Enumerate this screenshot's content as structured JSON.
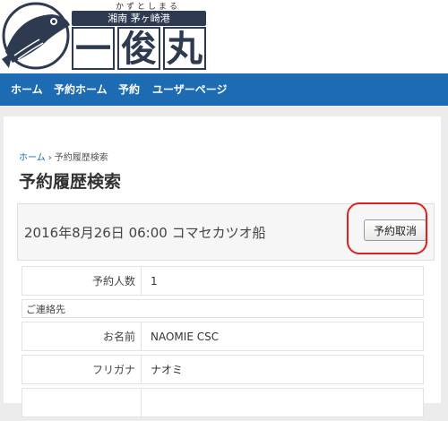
{
  "logo": {
    "furigana": "かずとしまる",
    "port": "湘南 茅ヶ崎港",
    "kanji": [
      "一",
      "俊",
      "丸"
    ]
  },
  "nav": {
    "items": [
      "ホーム",
      "予約ホーム",
      "予約",
      "ユーザーページ"
    ]
  },
  "breadcrumb": {
    "home": "ホーム",
    "separator": "›",
    "current": "予約履歴検索"
  },
  "page_title": "予約履歴検索",
  "booking": {
    "title": "2016年8月26日 06:00 コマセカツオ船",
    "cancel_label": "予約取消"
  },
  "details": {
    "people_label": "予約人数",
    "people_value": "1",
    "contact_section": "ご連絡先",
    "name_label": "お名前",
    "name_value": "NAOMIE CSC",
    "kana_label": "フリガナ",
    "kana_value": "ナオミ"
  },
  "colors": {
    "nav_bg": "#1c6bb3",
    "logo_navy": "#2e3a4f",
    "highlight": "#e02020"
  }
}
